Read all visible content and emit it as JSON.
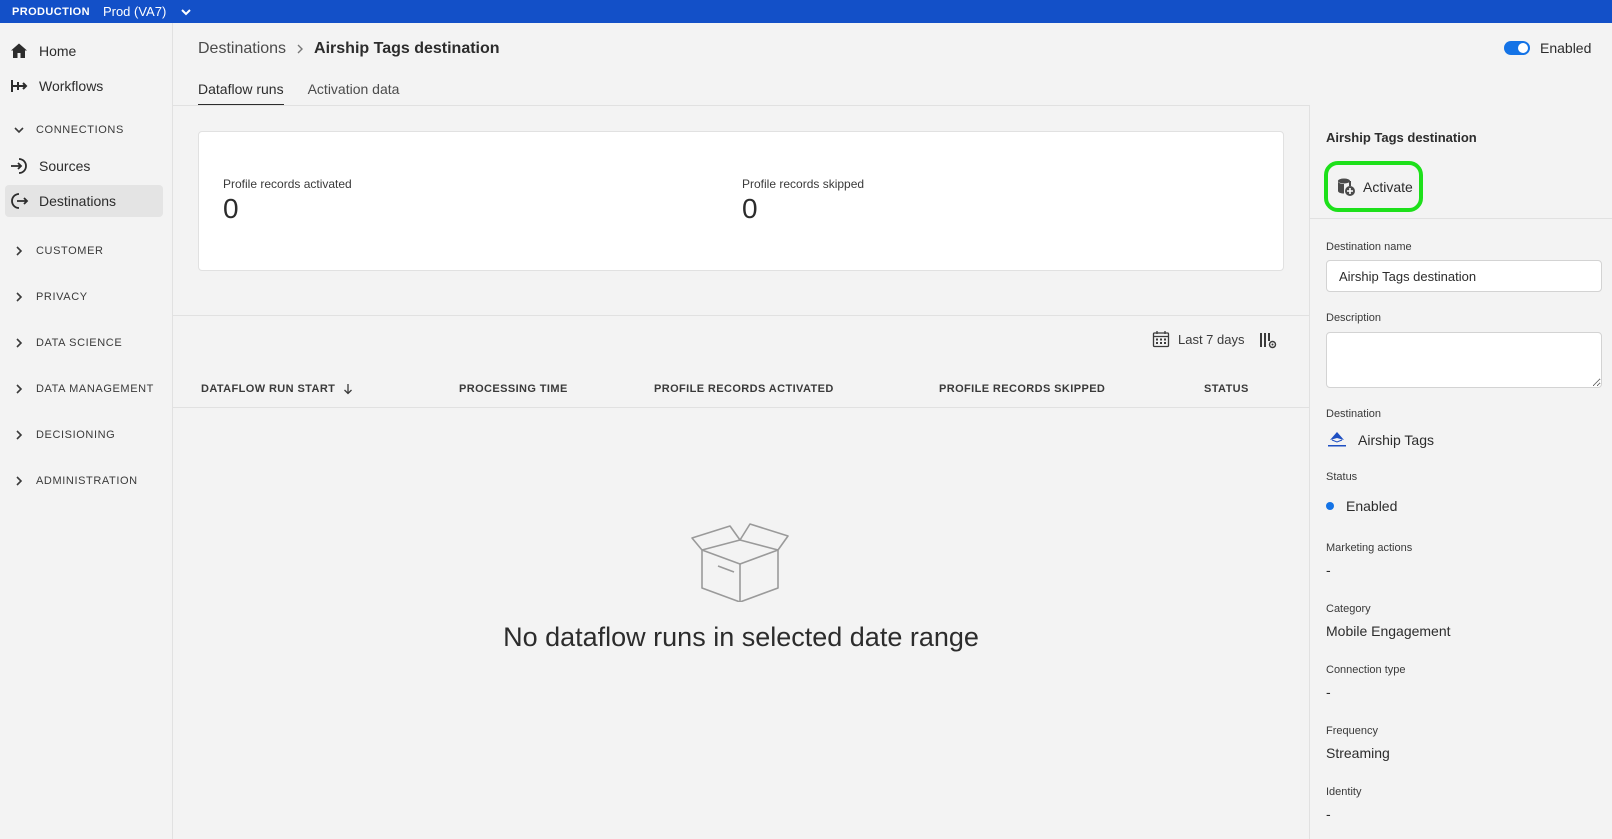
{
  "topbar": {
    "environment": "PRODUCTION",
    "sandbox": "Prod (VA7)"
  },
  "sidebar": {
    "items": [
      {
        "label": "Home",
        "icon": "home-icon"
      },
      {
        "label": "Workflows",
        "icon": "workflows-icon"
      }
    ],
    "connections_label": "CONNECTIONS",
    "connection_items": [
      {
        "label": "Sources",
        "icon": "sources-icon"
      },
      {
        "label": "Destinations",
        "icon": "destinations-icon",
        "active": true
      }
    ],
    "sections": [
      "CUSTOMER",
      "PRIVACY",
      "DATA SCIENCE",
      "DATA MANAGEMENT",
      "DECISIONING",
      "ADMINISTRATION"
    ]
  },
  "header": {
    "breadcrumb_parent": "Destinations",
    "breadcrumb_current": "Airship Tags destination",
    "toggle_label": "Enabled"
  },
  "tabs": [
    "Dataflow runs",
    "Activation data"
  ],
  "metrics": [
    {
      "label": "Profile records activated",
      "value": "0"
    },
    {
      "label": "Profile records skipped",
      "value": "0"
    }
  ],
  "table": {
    "date_range": "Last 7 days",
    "columns": [
      "DATAFLOW RUN START",
      "PROCESSING TIME",
      "PROFILE RECORDS ACTIVATED",
      "PROFILE RECORDS SKIPPED",
      "STATUS"
    ],
    "empty_message": "No dataflow runs in selected date range"
  },
  "panel": {
    "title": "Airship Tags destination",
    "activate_label": "Activate",
    "destination_name_label": "Destination name",
    "destination_name_value": "Airship Tags destination",
    "description_label": "Description",
    "destination_label": "Destination",
    "destination_value": "Airship Tags",
    "status_label": "Status",
    "status_value": "Enabled",
    "marketing_label": "Marketing actions",
    "marketing_value": "-",
    "category_label": "Category",
    "category_value": "Mobile Engagement",
    "connection_label": "Connection type",
    "connection_value": "-",
    "frequency_label": "Frequency",
    "frequency_value": "Streaming",
    "identity_label": "Identity",
    "identity_value": "-"
  },
  "colors": {
    "topbar": "#1350c8",
    "accent": "#1473e6",
    "highlight": "#1de01a"
  }
}
